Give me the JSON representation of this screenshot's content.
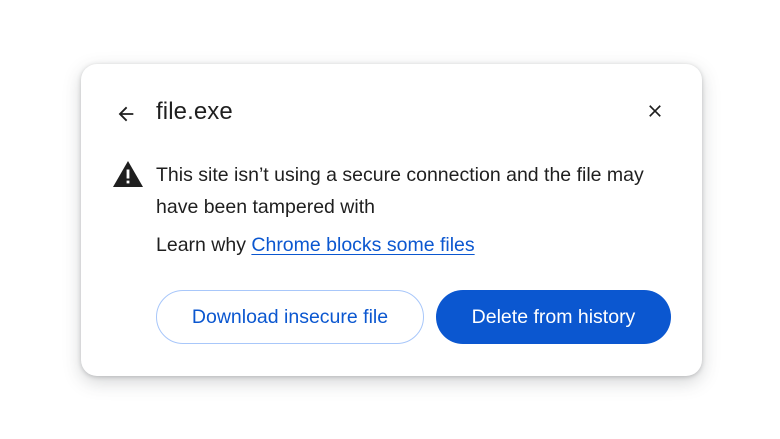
{
  "dialog": {
    "title": "file.exe",
    "back_icon": "arrow-back-icon",
    "close_icon": "close-icon",
    "warning_icon": "warning-triangle-icon",
    "message": "This site isn’t using a secure connection and the file may have been tampered with",
    "learn_prefix": "Learn why ",
    "learn_link": "Chrome blocks some files",
    "buttons": {
      "download_label": "Download insecure file",
      "delete_label": "Delete from history"
    }
  },
  "colors": {
    "accent": "#0b57d0",
    "outline": "#a8c7fa",
    "text": "#1f1f1f"
  }
}
